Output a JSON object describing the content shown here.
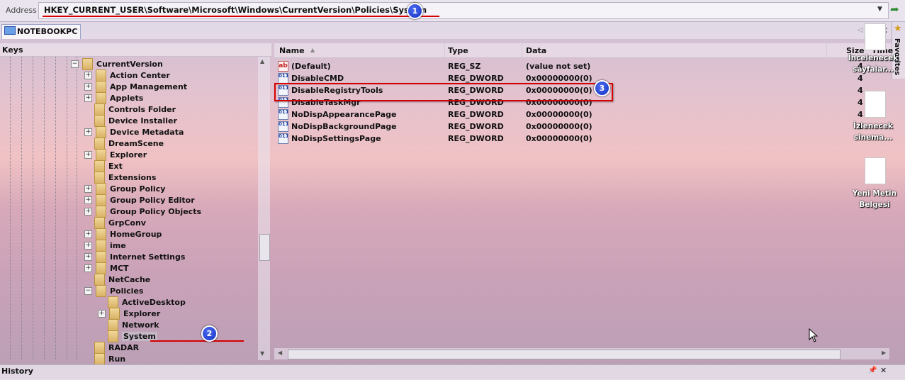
{
  "address": {
    "label": "Address",
    "path": "HKEY_CURRENT_USER\\Software\\Microsoft\\Windows\\CurrentVersion\\Policies\\System",
    "badge": "1"
  },
  "tab": {
    "label": "NOTEBOOKPC"
  },
  "favorites": {
    "label": "Favorites"
  },
  "keys": {
    "title": "Keys",
    "items": [
      {
        "label": "CurrentVersion"
      },
      {
        "label": "Action Center"
      },
      {
        "label": "App Management"
      },
      {
        "label": "Applets"
      },
      {
        "label": "Controls Folder"
      },
      {
        "label": "Device Installer"
      },
      {
        "label": "Device Metadata"
      },
      {
        "label": "DreamScene"
      },
      {
        "label": "Explorer"
      },
      {
        "label": "Ext"
      },
      {
        "label": "Extensions"
      },
      {
        "label": "Group Policy"
      },
      {
        "label": "Group Policy Editor"
      },
      {
        "label": "Group Policy Objects"
      },
      {
        "label": "GrpConv"
      },
      {
        "label": "HomeGroup"
      },
      {
        "label": "ime"
      },
      {
        "label": "Internet Settings"
      },
      {
        "label": "MCT"
      },
      {
        "label": "NetCache"
      },
      {
        "label": "Policies"
      },
      {
        "label": "ActiveDesktop"
      },
      {
        "label": "Explorer"
      },
      {
        "label": "Network"
      },
      {
        "label": "System"
      },
      {
        "label": "RADAR"
      },
      {
        "label": "Run"
      }
    ],
    "badge": "2"
  },
  "values": {
    "columns": {
      "name": "Name",
      "type": "Type",
      "data": "Data",
      "size": "Size",
      "time": "Time"
    },
    "rows": [
      {
        "name": "(Default)",
        "type": "REG_SZ",
        "data": "(value not set)",
        "size": "4",
        "icon": "string-value-icon"
      },
      {
        "name": "DisableCMD",
        "type": "REG_DWORD",
        "data": "0x00000000(0)",
        "size": "4",
        "icon": "dword-value-icon"
      },
      {
        "name": "DisableRegistryTools",
        "type": "REG_DWORD",
        "data": "0x00000000(0)",
        "size": "4",
        "icon": "dword-value-icon"
      },
      {
        "name": "DisableTaskMgr",
        "type": "REG_DWORD",
        "data": "0x00000000(0)",
        "size": "4",
        "icon": "dword-value-icon"
      },
      {
        "name": "NoDispAppearancePage",
        "type": "REG_DWORD",
        "data": "0x00000000(0)",
        "size": "4",
        "icon": "dword-value-icon"
      },
      {
        "name": "NoDispBackgroundPage",
        "type": "REG_DWORD",
        "data": "0x00000000(0)",
        "size": "4",
        "icon": "dword-value-icon"
      },
      {
        "name": "NoDispSettingsPage",
        "type": "REG_DWORD",
        "data": "0x00000000(0)",
        "size": "",
        "icon": "dword-value-icon"
      }
    ],
    "badge": "3"
  },
  "history": {
    "title": "History"
  },
  "desktop": {
    "icons": [
      {
        "label1": "İncelenecek",
        "label2": "sayfalar..."
      },
      {
        "label1": "İzlenecek",
        "label2": "sinema..."
      },
      {
        "label1": "Yeni Metin",
        "label2": "Belgesi"
      }
    ]
  },
  "colors": {
    "annotation": "#d40000",
    "badge": "#1d3bd6"
  }
}
